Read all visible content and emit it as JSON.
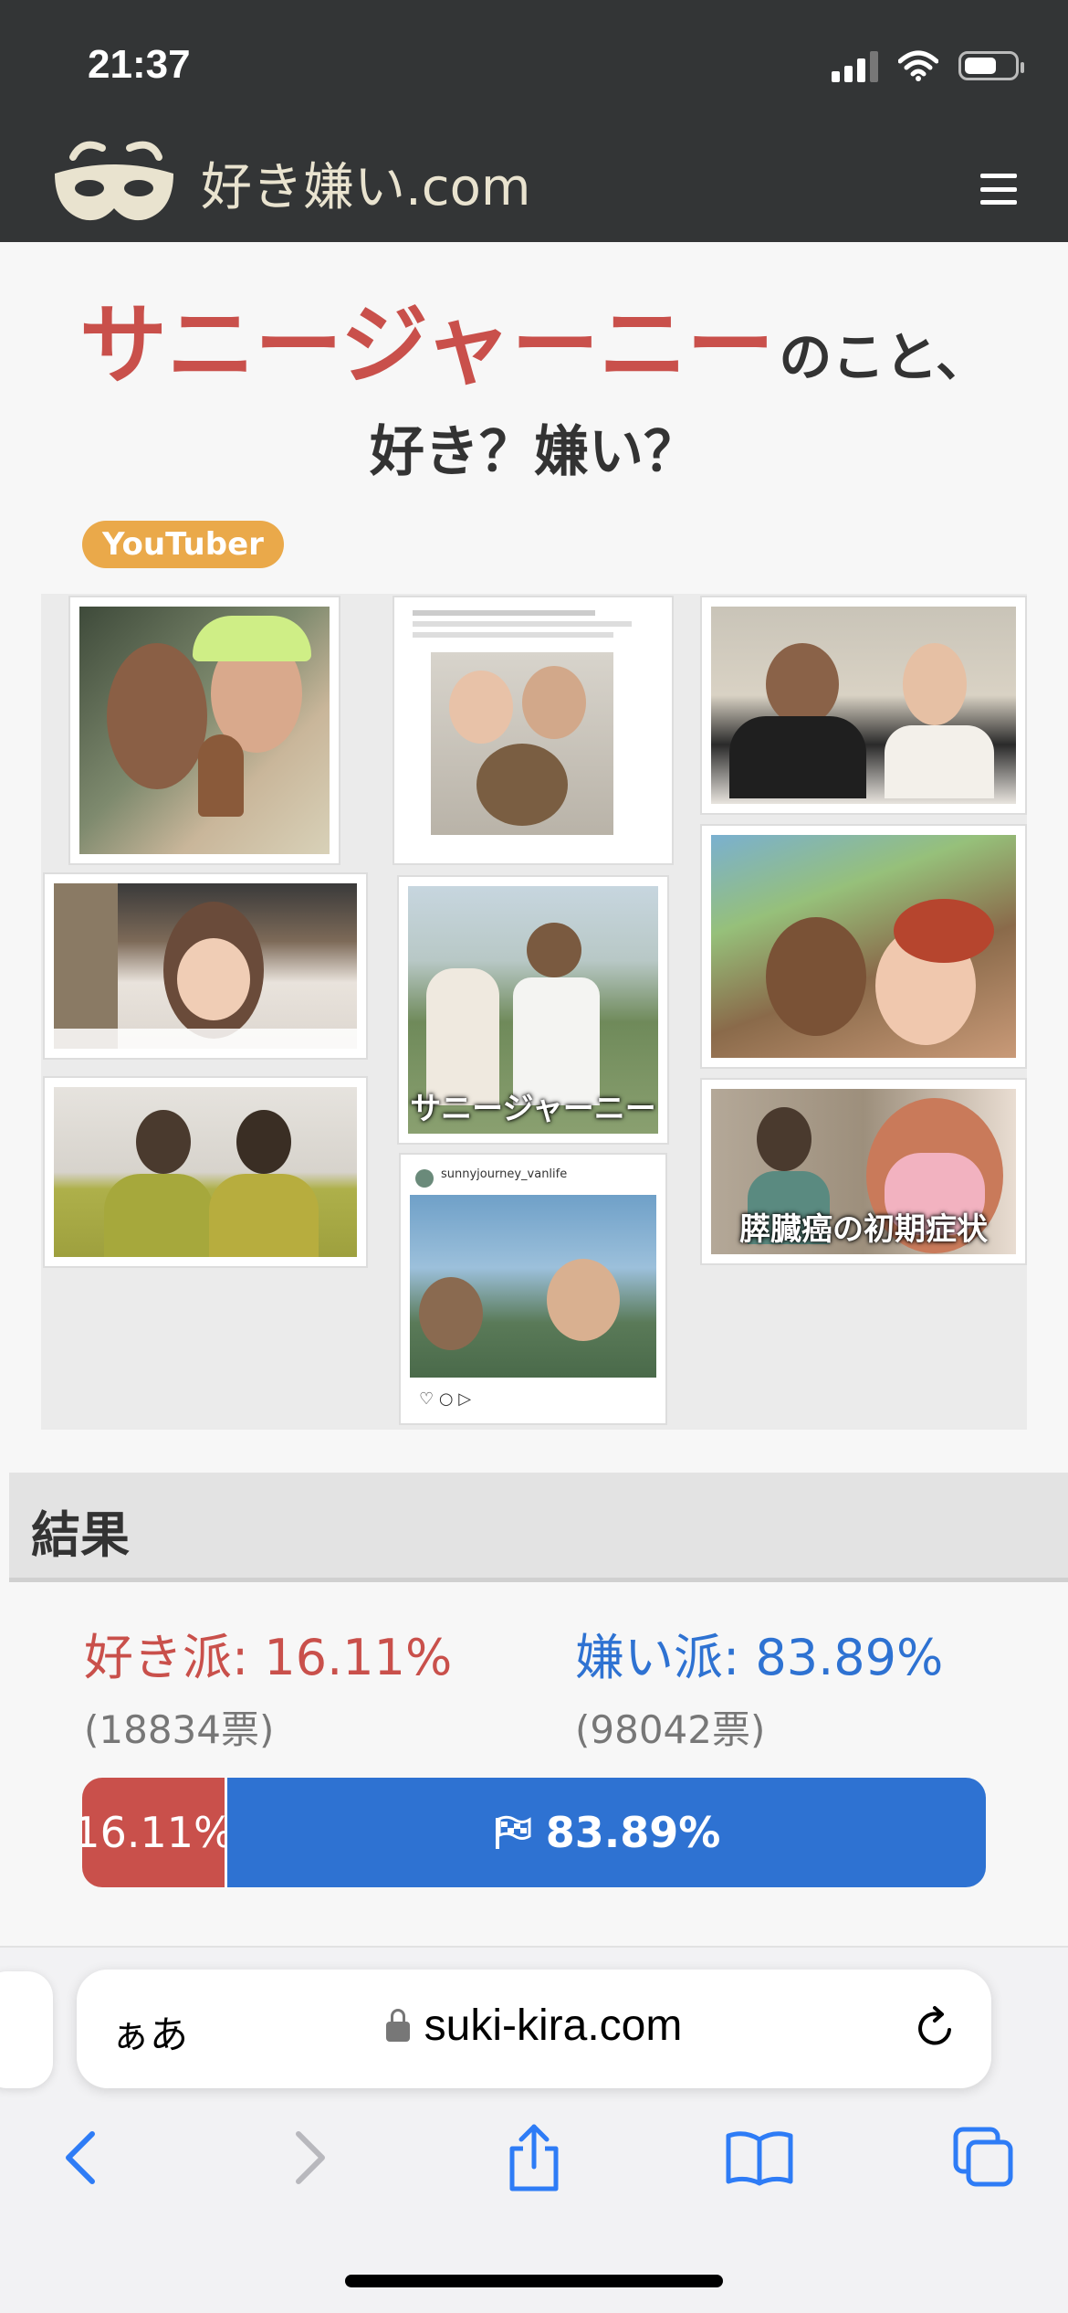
{
  "status_bar": {
    "time": "21:37"
  },
  "header": {
    "site_name": "好き嫌い.com",
    "menu_icon": "hamburger-icon"
  },
  "title": {
    "name": "サニージャーニー",
    "suffix": "のこと、",
    "question": "好き？嫌い？"
  },
  "category_tag": "YouTuber",
  "collage": {
    "captions": [
      "サニージャーニー",
      "膵臓癌の初期症状"
    ],
    "post_account": "sunnyjourney_vanlife"
  },
  "results": {
    "heading": "結果",
    "like_label": "好き派: 16.11%",
    "dislike_label": "嫌い派: 83.89%",
    "like_votes": "(18834票)",
    "dislike_votes": "(98042票)",
    "like_bar_text": "16.11%",
    "dislike_bar_text": "83.89%",
    "like_fraction": 0.1611,
    "colors": {
      "like": "#c9504b",
      "dislike": "#2e72d2"
    }
  },
  "browser": {
    "text_size_button": "ぁあ",
    "url": "suki-kira.com",
    "icons": [
      "back-icon",
      "forward-icon",
      "share-icon",
      "bookmarks-icon",
      "tabs-icon"
    ]
  }
}
